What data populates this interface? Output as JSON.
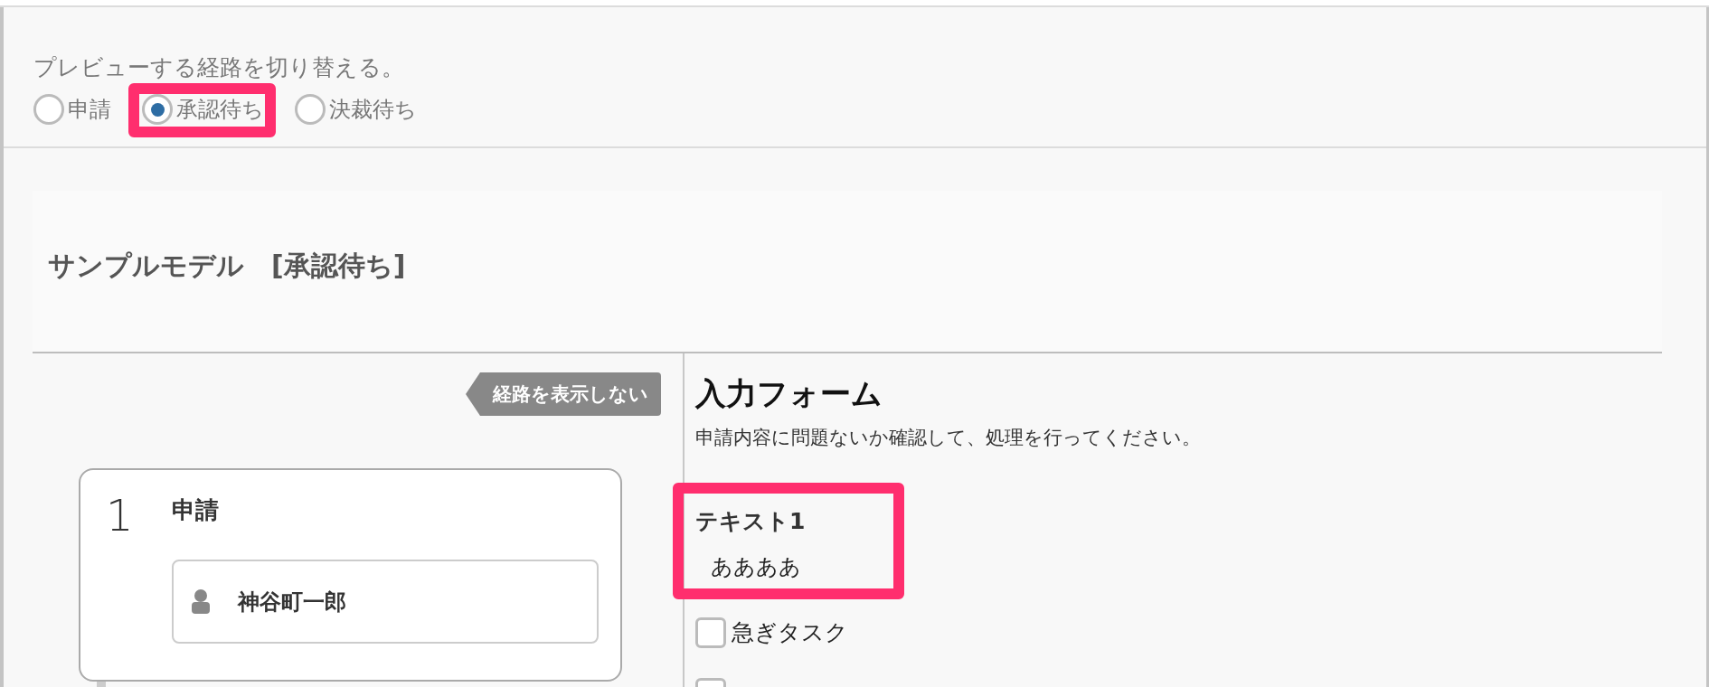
{
  "preview_switch": {
    "label": "プレビューする経路を切り替える。",
    "options": [
      {
        "label": "申請",
        "selected": false,
        "highlighted": false
      },
      {
        "label": "承認待ち",
        "selected": true,
        "highlighted": true
      },
      {
        "label": "決裁待ち",
        "selected": false,
        "highlighted": false
      }
    ]
  },
  "model": {
    "title": "サンプルモデル　[承認待ち]"
  },
  "route": {
    "toggle_button": "経路を表示しない",
    "steps": [
      {
        "number": "1",
        "name": "申請",
        "assignees": [
          "神谷町一郎"
        ]
      }
    ]
  },
  "form": {
    "title": "入力フォーム",
    "description": "申請内容に問題ないか確認して、処理を行ってください。",
    "fields": [
      {
        "label": "テキスト1",
        "value": "ああああ",
        "highlighted": true
      }
    ],
    "checkboxes": [
      {
        "label": "急ぎタスク",
        "checked": false
      },
      {
        "checked": false
      }
    ]
  }
}
